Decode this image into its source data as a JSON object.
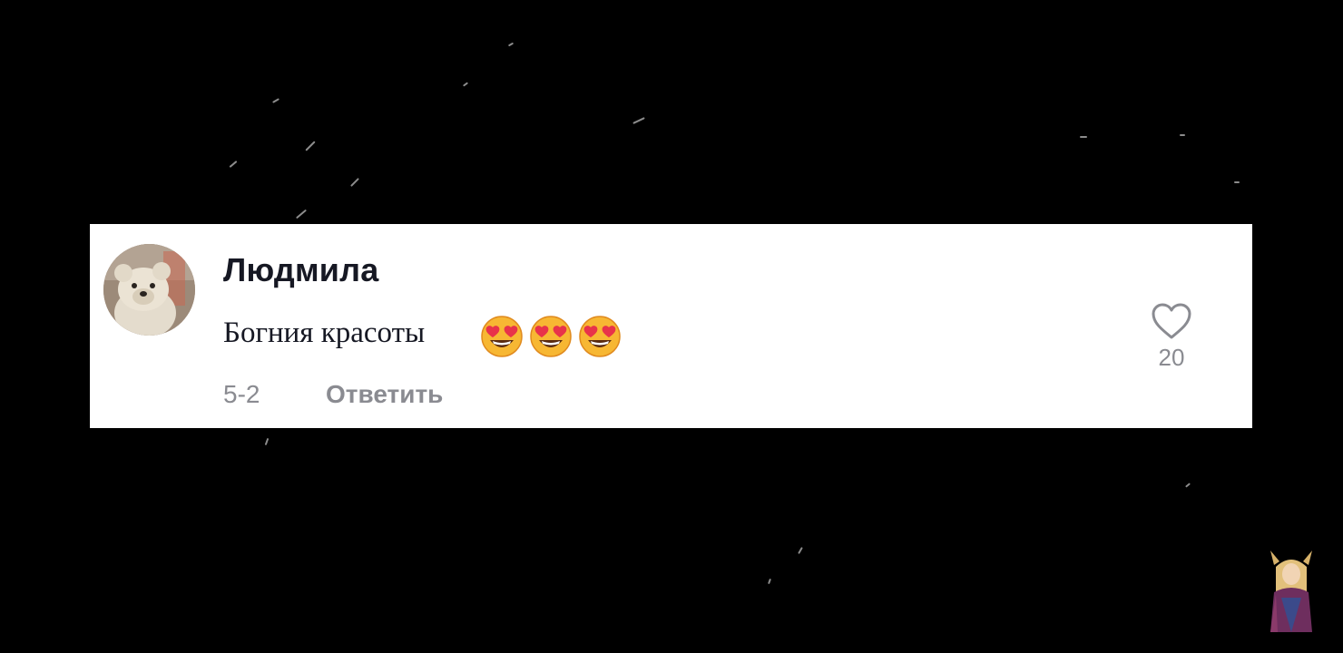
{
  "comment": {
    "username": "Людмила",
    "text": "Богния красоты",
    "emojis": [
      "heart-eyes-emoji",
      "heart-eyes-emoji",
      "heart-eyes-emoji"
    ],
    "date": "5-2",
    "reply_label": "Ответить",
    "like_count": "20"
  },
  "colors": {
    "background": "#000000",
    "card": "#ffffff",
    "primary_text": "#161823",
    "secondary_text": "#8a8b91"
  }
}
